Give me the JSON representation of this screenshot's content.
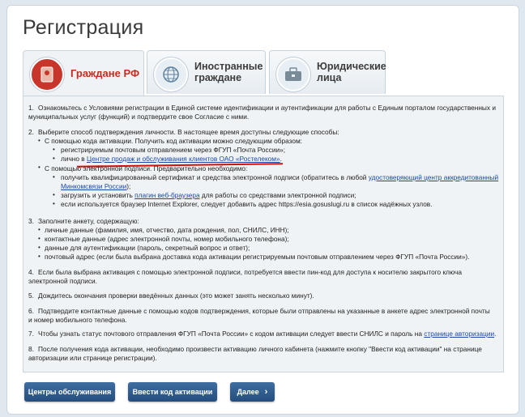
{
  "page": {
    "title": "Регистрация"
  },
  "tabs": [
    {
      "label": "Граждане РФ",
      "icon": "passport-icon"
    },
    {
      "label1": "Иностранные",
      "label2": "граждане",
      "icon": "globe-icon"
    },
    {
      "label1": "Юридические",
      "label2": "лица",
      "icon": "briefcase-icon"
    }
  ],
  "steps": {
    "s1": {
      "num": "1.",
      "l1": "Ознакомьтесь с Условиями регистрации в Единой системе идентификации и аутентификации для работы с Единым порталом государственных и",
      "l2": "муниципальных услуг (функций) и подтвердите свое Согласие с ними."
    },
    "s2": {
      "num": "2.",
      "l1": "Выберите способ подтверждения личности. В настоящее время доступны следующие способы:",
      "a": "С помощью кода активации. Получить код активации можно следующим образом:",
      "a1": "регистрируемым почтовым отправлением через ФГУП «Почта России»;",
      "a2_pre": "лично в ",
      "a2_link": "Центре продаж и обслуживания клиентов ОАО «Ростелеком»",
      "a2_post": ".",
      "b": "С помощью электронной подписи. Предварительно необходимо:",
      "b1_pre": "получить квалифицированный сертификат и средства электронной подписи (обратитесь в любой ",
      "b1_link1": "удостоверяющий центр аккредитованный",
      "b1_link2": "Минкомсвязи России",
      "b1_post": ");",
      "b2_pre": "загрузить и установить ",
      "b2_link": "плагин веб-браузера",
      "b2_post": " для работы со средствами электронной подписи;",
      "b3": "если используется браузер Internet Explorer, следует добавить адрес https://esia.gosuslugi.ru в список надёжных узлов."
    },
    "s3": {
      "num": "3.",
      "l1": "Заполните анкету, содержащую:",
      "i1": "личные данные (фамилия, имя, отчество, дата рождения, пол, СНИЛС, ИНН);",
      "i2": "контактные данные (адрес электронной почты, номер мобильного телефона);",
      "i3": "данные для аутентификации (пароль, секретный вопрос и ответ);",
      "i4": "почтовый адрес (если была выбрана доставка кода активации регистрируемым почтовым отправлением через ФГУП «Почта России»)."
    },
    "s4": {
      "num": "4.",
      "l1": "Если была выбрана активация с помощью электронной подписи, потребуется ввести пин-код для доступа к носителю закрытого ключа",
      "l2": "электронной подписи."
    },
    "s5": {
      "num": "5.",
      "l1": "Дождитесь окончания проверки введённых данных (это может занять несколько минут)."
    },
    "s6": {
      "num": "6.",
      "l1": "Подтвердите контактные данные с помощью кодов подтверждения, которые были отправлены на указанные в анкете адрес электронной почты",
      "l2": "и номер мобильного телефона."
    },
    "s7": {
      "num": "7.",
      "pre": "Чтобы узнать статус почтового отправления ФГУП «Почта России» с кодом активации следует ввести СНИЛС и пароль на ",
      "link": "странице авторизации",
      "post": "."
    },
    "s8": {
      "num": "8.",
      "l1": "После получения кода активации, необходимо произвести активацию личного кабинета (нажмите кнопку \"Ввести код активации\" на странице",
      "l2": "авторизации или странице регистрации)."
    }
  },
  "buttons": {
    "centers": "Центры обслуживания",
    "enter_code": "Ввести код активации",
    "next": "Далее"
  },
  "colors": {
    "accent_red": "#c82a1f",
    "link": "#1b48a8",
    "button": "#2e5c8f"
  }
}
